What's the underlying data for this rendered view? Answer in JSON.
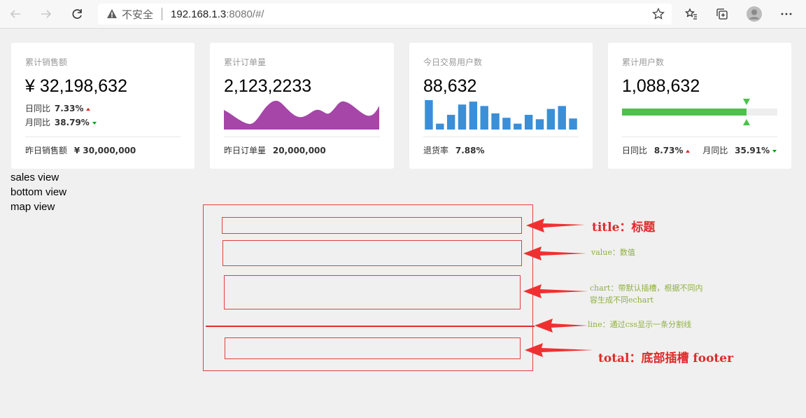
{
  "browser": {
    "insecure_label": "不安全",
    "url_host": "192.168.1.3",
    "url_path": ":8080/#/"
  },
  "cards": [
    {
      "title": "累计销售额",
      "value": "¥ 32,198,632",
      "day_label": "日同比",
      "day_value": "7.33%",
      "month_label": "月同比",
      "month_value": "38.79%",
      "footer_label": "昨日销售额",
      "footer_value": "¥ 30,000,000"
    },
    {
      "title": "累计订单量",
      "value": "2,123,2233",
      "footer_label": "昨日订单量",
      "footer_value": "20,000,000",
      "area_color": "#a546a8"
    },
    {
      "title": "今日交易用户数",
      "value": "88,632",
      "footer_label": "退货率",
      "footer_value": "7.88%",
      "bar_color": "#3a8fd8",
      "bars": [
        40,
        8,
        20,
        34,
        38,
        32,
        22,
        16,
        8,
        20,
        14,
        28,
        32,
        15
      ]
    },
    {
      "title": "累计用户数",
      "value": "1,088,632",
      "progress": 0.8,
      "progress_color": "#4bc24b",
      "track_color": "#eeeeee",
      "day_label": "日同比",
      "day_value": "8.73%",
      "month_label": "月同比",
      "month_value": "35.91%"
    }
  ],
  "left_text": [
    "sales view",
    "bottom view",
    "map view"
  ],
  "annotations": {
    "title": "title：标题",
    "value": "value：数值",
    "chart_line1": "chart：带默认插槽，根据不同内",
    "chart_line2": "容生成不同echart",
    "line": "line：通过css显示一条分割线",
    "total": "total：底部插槽  footer"
  },
  "colors": {
    "annotation_red": "#e02a2a",
    "annotation_green": "#8fb040"
  }
}
